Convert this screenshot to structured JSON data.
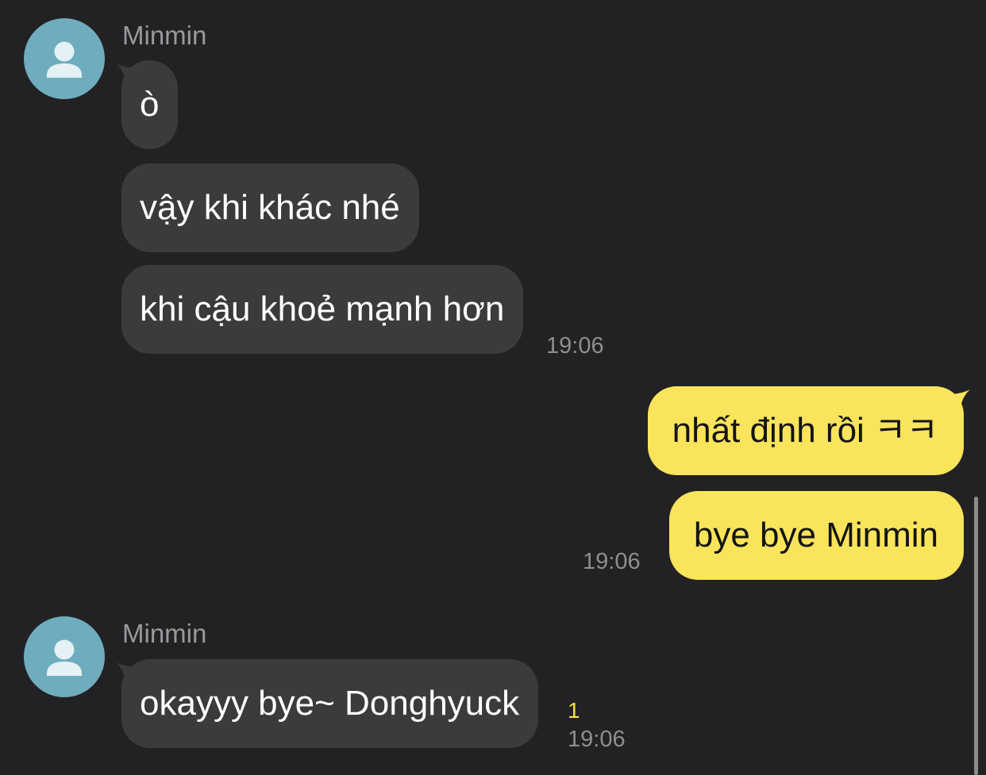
{
  "chat": {
    "groups": [
      {
        "sender": "Minmin",
        "avatar_icon": "person-icon",
        "messages": [
          "ò",
          "vậy khi khác nhé",
          "khi cậu khoẻ mạnh hơn"
        ],
        "time": "19:06"
      },
      {
        "sender": "me",
        "messages": [
          "nhất định rồi ㅋㅋ",
          "bye bye Minmin"
        ],
        "time": "19:06"
      },
      {
        "sender": "Minmin",
        "avatar_icon": "person-icon",
        "messages": [
          "okayyy bye~ Donghyuck"
        ],
        "unread_count": "1",
        "time": "19:06"
      }
    ]
  },
  "colors": {
    "background": "#222224",
    "incoming_bubble": "#3b3b3e",
    "outgoing_bubble": "#f9e45b",
    "avatar": "#6fadbe",
    "unread": "#f7e04a"
  }
}
